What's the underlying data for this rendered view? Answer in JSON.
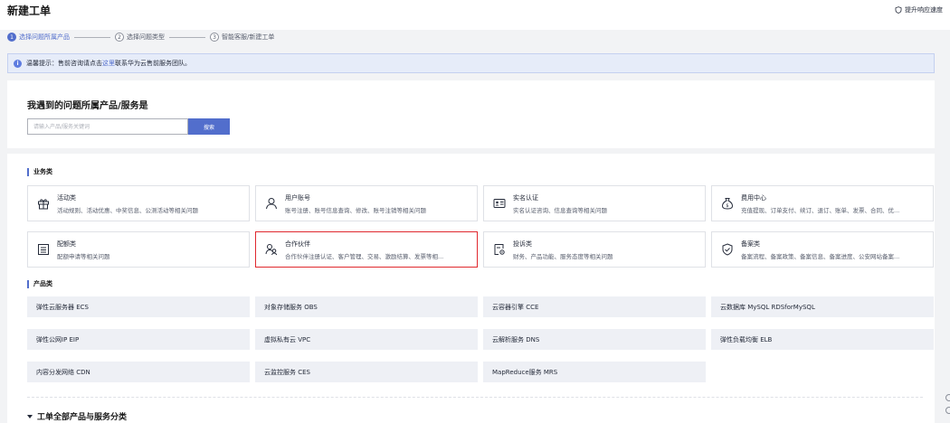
{
  "header": {
    "title": "新建工单",
    "speed_link": "提升响应速度"
  },
  "steps": [
    {
      "num": "1",
      "label": "选择问题所属产品"
    },
    {
      "num": "2",
      "label": "选择问题类型"
    },
    {
      "num": "3",
      "label": "智能客服/新建工单"
    }
  ],
  "notice": {
    "prefix": "温馨提示：售前咨询请点击",
    "link": "这里",
    "suffix": "联系华为云售前服务团队。"
  },
  "search": {
    "title": "我遇到的问题所属产品/服务是",
    "placeholder": "请输入产品/服务关键词",
    "button": "搜索"
  },
  "business": {
    "section_label": "业务类",
    "items": [
      {
        "icon": "gift-icon",
        "name": "活动类",
        "desc": "活动规则、活动优惠、中奖信息、公测活动等相关问题"
      },
      {
        "icon": "user-icon",
        "name": "用户账号",
        "desc": "账号注册、账号信息查询、修改、账号注销等相关问题"
      },
      {
        "icon": "id-card-icon",
        "name": "实名认证",
        "desc": "实名认证咨询、信息查询等相关问题"
      },
      {
        "icon": "money-bag-icon",
        "name": "费用中心",
        "desc": "充值提现、订单支付、续订、退订、账单、发票、合同、优..."
      },
      {
        "icon": "list-icon",
        "name": "配额类",
        "desc": "配额申请等相关问题"
      },
      {
        "icon": "partner-icon",
        "name": "合作伙伴",
        "desc": "合作伙伴注册认证、客户管理、交易、激励结算、发票等相..."
      },
      {
        "icon": "complaint-icon",
        "name": "投诉类",
        "desc": "财务、产品功能、服务态度等相关问题"
      },
      {
        "icon": "shield-check-icon",
        "name": "备案类",
        "desc": "备案流程、备案政策、备案信息、备案进度、公安网站备案..."
      }
    ]
  },
  "products": {
    "section_label": "产品类",
    "items": [
      "弹性云服务器 ECS",
      "对象存储服务 OBS",
      "云容器引擎 CCE",
      "云数据库 MySQL RDSforMySQL",
      "弹性公网IP EIP",
      "虚拟私有云 VPC",
      "云解析服务 DNS",
      "弹性负载均衡 ELB",
      "内容分发网络 CDN",
      "云监控服务 CES",
      "MapReduce服务 MRS"
    ]
  },
  "all_products": {
    "label": "工单全部产品与服务分类"
  },
  "colors": {
    "brand": "#526ecc",
    "selected_border": "#e0282e",
    "notice_bg": "#e6ecf9"
  }
}
